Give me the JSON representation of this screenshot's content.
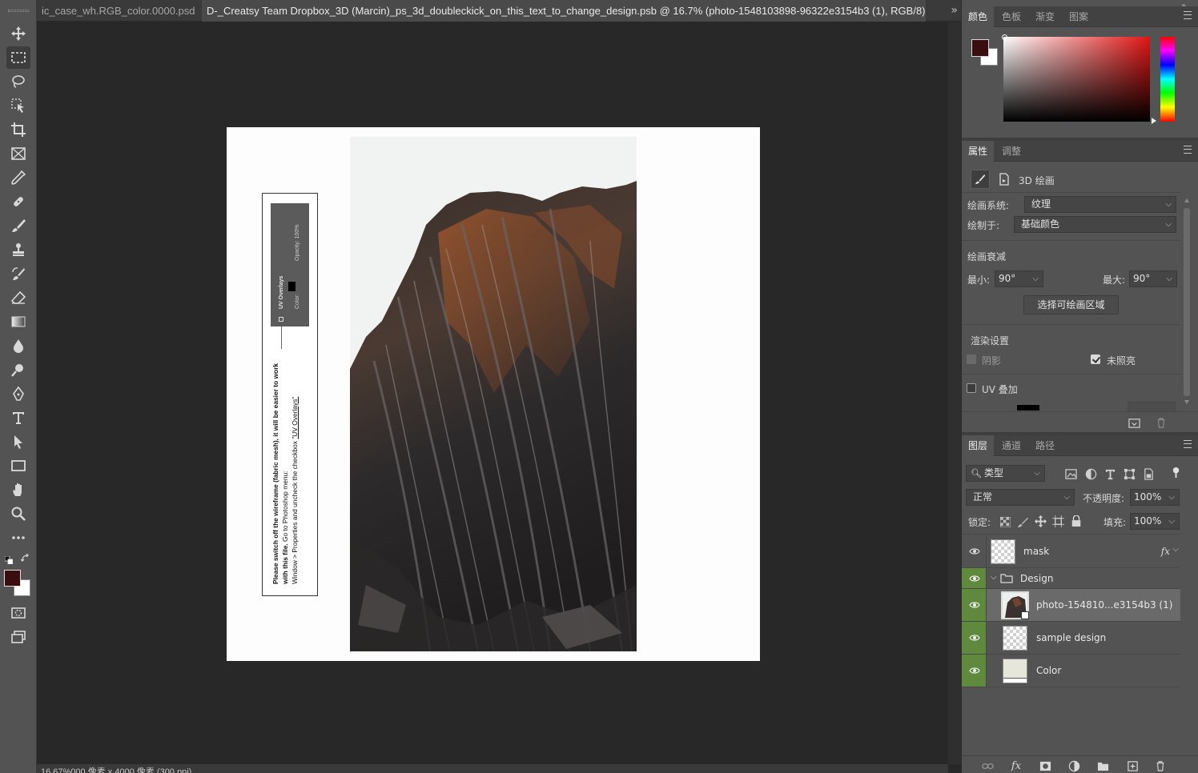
{
  "tabs": [
    {
      "label": "ic_case_wh.RGB_color.0000.psd",
      "close": "×"
    },
    {
      "label": "D-_Creatsy Team Dropbox_3D (Marcin)_ps_3d_doubleckick_on_this_text_to_change_design.psb @ 16.7% (photo-1548103898-96322e3154b3 (1), RGB/8) *",
      "close": "×"
    }
  ],
  "tab_overflow": "»",
  "status_bar": "16.67%000 像素 x 4000 像素 (300 ppi)",
  "document": {
    "instruction_bold": "Please switch off the wireframe (fabric mesh), it will be easier to work with this file.",
    "instruction_normal": " Go to Photoshop menu:",
    "instruction_line2": "Window > Properties and uncheck the checkbox ",
    "instruction_link": "\"UV Overlays\"",
    "mini_panel": {
      "uv_overlays": "UV Overlays",
      "color": "Color:",
      "opacity": "Opacity: 100%"
    }
  },
  "color_panel": {
    "tabs": [
      "颜色",
      "色板",
      "渐变",
      "图案"
    ],
    "foreground": "#3a0e0e",
    "background": "#ffffff"
  },
  "properties_panel": {
    "tabs": [
      "属性",
      "调整"
    ],
    "header": "3D 绘画",
    "paint_system_label": "绘画系统:",
    "paint_system_value": "纹理",
    "paint_on_label": "绘制于:",
    "paint_on_value": "基础颜色",
    "falloff_title": "绘画衰减",
    "min_label": "最小:",
    "min_value": "90°",
    "max_label": "最大:",
    "max_value": "90°",
    "select_paintable_button": "选择可绘画区域",
    "render_settings_title": "渲染设置",
    "shadow_label": "阴影",
    "unlit_label": "未照亮",
    "uv_overlay_label": "UV 叠加"
  },
  "layers_panel": {
    "tabs": [
      "图层",
      "通道",
      "路径"
    ],
    "filter_label": "类型",
    "blend_mode": "正常",
    "opacity_label": "不透明度:",
    "opacity_value": "100%",
    "lock_label": "锁定:",
    "fill_label": "填充:",
    "fill_value": "100%",
    "fx_label": "fx",
    "layers": [
      {
        "name": "mask",
        "visible": true,
        "selected": false,
        "has_fx": true
      },
      {
        "name": "Design",
        "visible": true,
        "group": true,
        "expanded": true
      },
      {
        "name": "photo-154810...e3154b3 (1)",
        "visible": true,
        "selected": true
      },
      {
        "name": "sample design",
        "visible": true,
        "selected": false
      },
      {
        "name": "Color",
        "visible": true,
        "selected": false
      }
    ]
  },
  "colors": {
    "ui_dark": "#282828",
    "panel": "#535353",
    "visible_green": "#5f8a3e",
    "selected_layer": "#6a6a6a"
  }
}
